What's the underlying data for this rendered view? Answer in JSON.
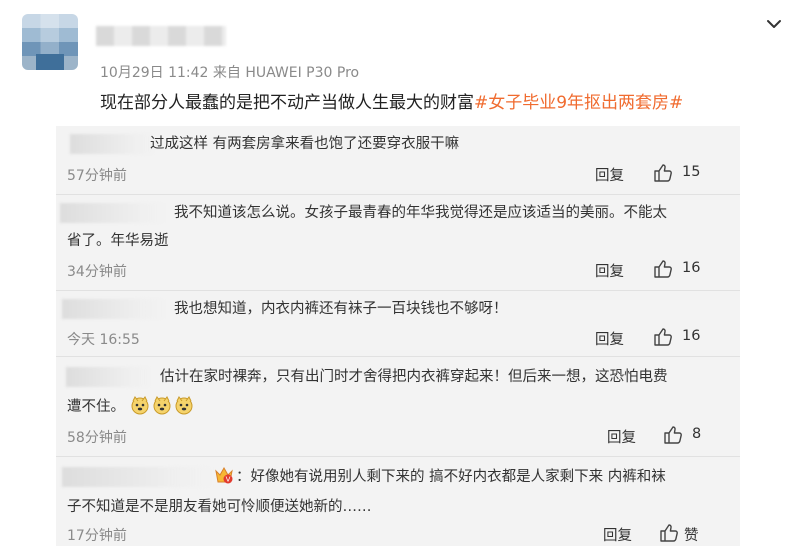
{
  "post": {
    "meta": "10月29日 11:42  来自 HUAWEI P30 Pro",
    "text": "现在部分人最蠢的是把不动产当做人生最大的财富",
    "topic": "#女子毕业9年抠出两套房#"
  },
  "comments": [
    {
      "text": "过成这样 有两套房拿来看也饱了还要穿衣服干嘛",
      "time": "57分钟前",
      "reply": "回复",
      "likes": "15"
    },
    {
      "text_line1": "我不知道该怎么说。女孩子最青春的年华我觉得还是应该适当的美丽。不能太",
      "text_line2": "省了。年华易逝",
      "time": "34分钟前",
      "reply": "回复",
      "likes": "16"
    },
    {
      "text": "我也想知道，内衣内裤还有袜子一百块钱也不够呀！",
      "time": "今天 16:55",
      "reply": "回复",
      "likes": "16"
    },
    {
      "text_line1": "估计在家时裸奔，只有出门时才舍得把内衣裤穿起来！但后来一想，这恐怕电费",
      "text_line2": "遭不住。",
      "time": "58分钟前",
      "reply": "回复",
      "likes": "8",
      "emoji_icon": "doge-emoji"
    },
    {
      "text_line1": "：好像她有说用别人剩下来的 搞不好内衣都是人家剩下来 内裤和袜",
      "text_line2": "子不知道是不是朋友看她可怜顺便送她新的……",
      "time": "17分钟前",
      "reply": "回复",
      "likes": "赞",
      "badge_icon": "vip-badge-icon"
    }
  ],
  "colors": {
    "topic": "#f06b2f",
    "panel_bg": "#f3f3f3",
    "meta_gray": "#8a8a8a"
  }
}
